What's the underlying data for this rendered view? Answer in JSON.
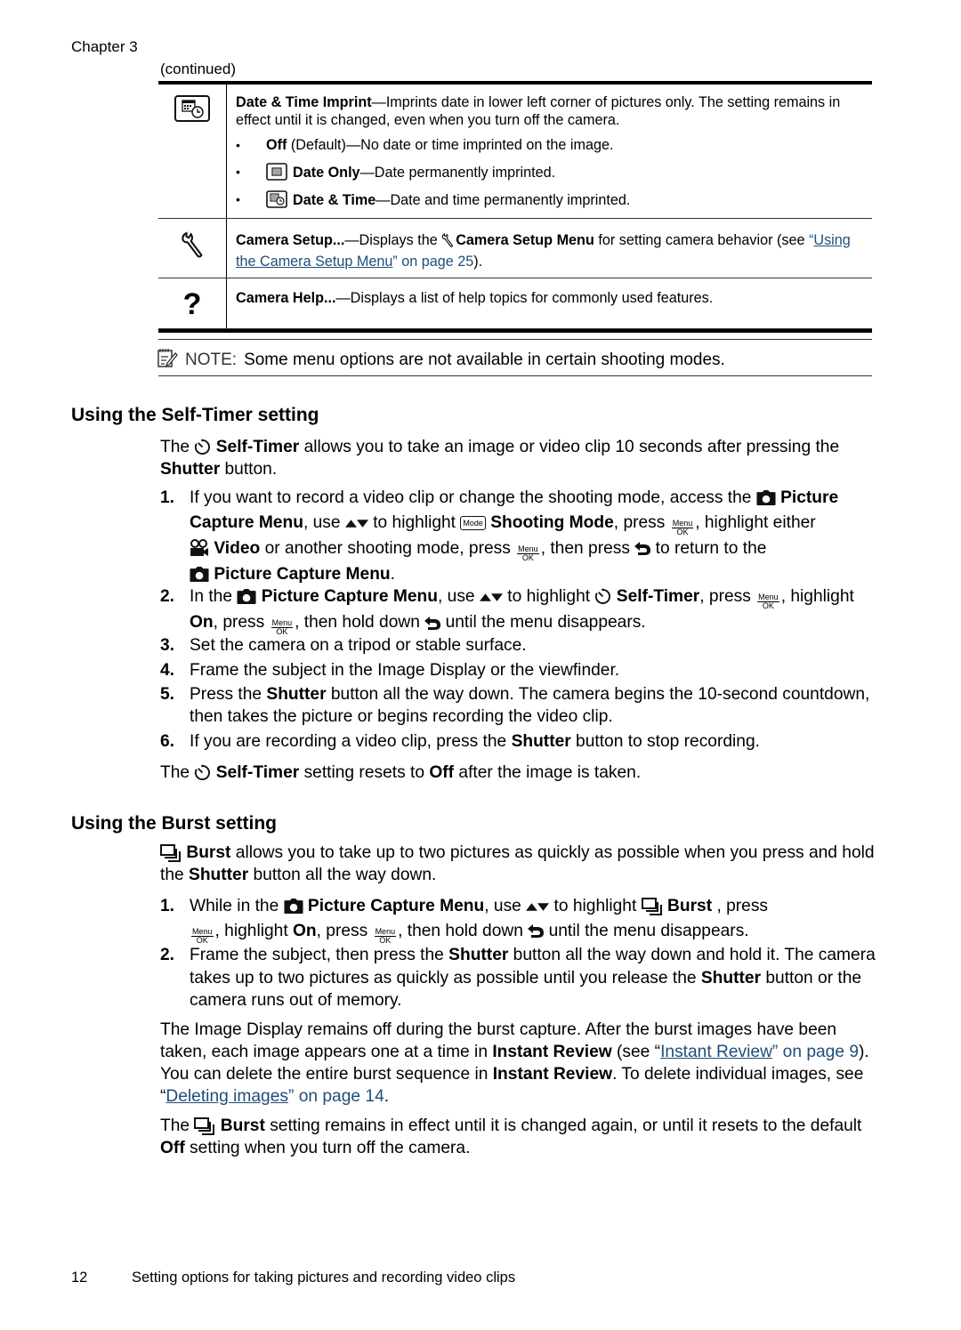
{
  "header": {
    "chapter": "Chapter 3",
    "continued": "(continued)"
  },
  "table": {
    "rows": [
      {
        "icon": "date-time-imprint-icon",
        "title": "Date & Time Imprint",
        "desc": "—Imprints date in lower left corner of pictures only. The setting remains in effect until it is changed, even when you turn off the camera.",
        "bullets": [
          {
            "label": "Off",
            "rest": " (Default)—No date or time imprinted on the image."
          },
          {
            "icon": "date-only-icon",
            "label": "Date Only",
            "rest": "—Date permanently imprinted."
          },
          {
            "icon": "date-time-icon",
            "label": "Date & Time",
            "rest": "—Date and time permanently imprinted."
          }
        ]
      },
      {
        "icon": "wrench-icon",
        "title": "Camera Setup...",
        "desc_a": "—Displays the ",
        "menu_name": "Camera Setup Menu",
        "desc_b": " for setting camera behavior (see ",
        "link_text": "Using the Camera Setup Menu",
        "link_page": " on page 25",
        "desc_c": ")."
      },
      {
        "icon": "question-icon",
        "title": "Camera Help...",
        "desc": "—Displays a list of help topics for commonly used features."
      }
    ]
  },
  "note": {
    "label": "NOTE:",
    "text": "Some menu options are not available in certain shooting modes."
  },
  "self_timer": {
    "heading": "Using the Self-Timer setting",
    "intro": {
      "a": "The ",
      "b": "Self-Timer",
      "c": " allows you to take an image or video clip 10 seconds after pressing the ",
      "d": "Shutter",
      "e": " button."
    },
    "steps": [
      {
        "num": "1."
      },
      {
        "num": "2."
      },
      {
        "num": "3.",
        "text": "Set the camera on a tripod or stable surface."
      },
      {
        "num": "4.",
        "text": "Frame the subject in the Image Display or the viewfinder."
      },
      {
        "num": "5."
      },
      {
        "num": "6."
      }
    ],
    "s1": {
      "a": "If you want to record a video clip or change the shooting mode, access the ",
      "b": "Picture Capture Menu",
      "c": ", use ",
      "d": " to highlight ",
      "e": "Shooting Mode",
      "f": ", press ",
      "g": ", highlight either ",
      "h": "Video",
      "i": " or another shooting mode, press ",
      "j": ", then press ",
      "k": " to return to the ",
      "l": "Picture Capture Menu",
      "m": "."
    },
    "s2": {
      "a": "In the ",
      "b": "Picture Capture Menu",
      "c": ", use ",
      "d": " to highlight ",
      "e": "Self-Timer",
      "f": ", press ",
      "g": ", highlight ",
      "h": "On",
      "i": ", press ",
      "j": ", then hold down ",
      "k": " until the menu disappears."
    },
    "s5": {
      "a": "Press the ",
      "b": "Shutter",
      "c": " button all the way down. The camera begins the 10-second countdown, then takes the picture or begins recording the video clip."
    },
    "s6": {
      "a": "If you are recording a video clip, press the ",
      "b": "Shutter",
      "c": " button to stop recording."
    },
    "outro": {
      "a": "The ",
      "b": "Self-Timer",
      "c": " setting resets to ",
      "d": "Off",
      "e": " after the image is taken."
    }
  },
  "burst": {
    "heading": "Using the Burst setting",
    "intro": {
      "b": "Burst",
      "c": " allows you to take up to two pictures as quickly as possible when you press and hold the ",
      "d": "Shutter",
      "e": " button all the way down."
    },
    "s1": {
      "num": "1.",
      "a": "While in the ",
      "b": "Picture Capture Menu",
      "c": ", use ",
      "d": " to highlight ",
      "e": "Burst",
      "f": " , press ",
      "g": ", highlight ",
      "h": "On",
      "i": ", press ",
      "j": ", then hold down ",
      "k": " until the menu disappears."
    },
    "s2": {
      "num": "2.",
      "a": "Frame the subject, then press the ",
      "b": "Shutter",
      "c": " button all the way down and hold it. The camera takes up to two pictures as quickly as possible until you release the ",
      "d": "Shutter",
      "e": " button or the camera runs out of memory."
    },
    "p1": {
      "a": "The Image Display remains off during the burst capture. After the burst images have been taken, each image appears one at a time in ",
      "b": "Instant Review",
      "c": " (see “",
      "link1": "Instant Review",
      "d": "” on page 9",
      "e": "). You can delete the entire burst sequence in ",
      "f": "Instant Review",
      "g": ". To delete individual images, see “",
      "link2": "Deleting images",
      "h": "” on page 14",
      "i": "."
    },
    "p2": {
      "a": "The ",
      "b": "Burst",
      "c": " setting remains in effect until it is changed again, or until it resets to the default ",
      "d": "Off",
      "e": " setting when you turn off the camera."
    }
  },
  "button_labels": {
    "menu_top": "Menu",
    "menu_bottom": "OK",
    "mode": "Mode"
  },
  "footer": {
    "page_number": "12",
    "title": "Setting options for taking pictures and recording video clips"
  },
  "colors": {
    "link": "#1f4e79",
    "text": "#000000"
  }
}
